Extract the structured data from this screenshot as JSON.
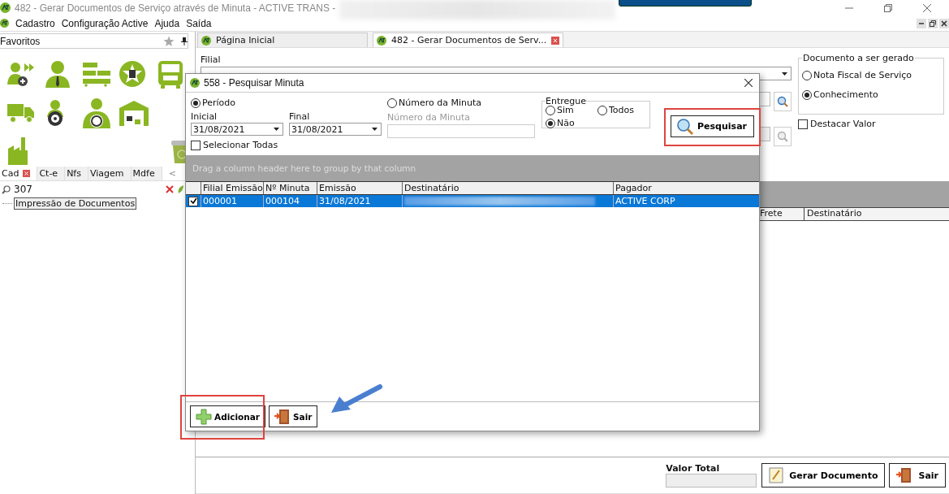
{
  "window": {
    "title": "482 - Gerar Documentos de Serviço através de Minuta - ACTIVE TRANS -"
  },
  "menu": [
    "Cadastro",
    "Configuração Active",
    "Ajuda",
    "Saída"
  ],
  "favorites": {
    "title": "Favoritos"
  },
  "side_tabs": [
    {
      "label": "Cad",
      "selected": true,
      "closable": true
    },
    {
      "label": "Ct-e",
      "selected": false,
      "closable": false
    },
    {
      "label": "Nfs",
      "selected": false,
      "closable": false
    },
    {
      "label": "Viagem",
      "selected": false,
      "closable": false
    },
    {
      "label": "Mdfe",
      "selected": false,
      "closable": false
    }
  ],
  "side_nav": "<",
  "side_search": {
    "value": "307"
  },
  "tree": [
    {
      "label": "Impressão de Documentos",
      "selected": true
    }
  ],
  "doc_tabs": [
    {
      "label": "Página Inicial",
      "selected": false,
      "closable": false
    },
    {
      "label": "482 - Gerar Documentos de Serv...",
      "selected": true,
      "closable": true
    }
  ],
  "form": {
    "filial_label": "Filial",
    "document_group": {
      "title": "Documento a ser gerado",
      "options": [
        {
          "label": "Nota Fiscal de Serviço",
          "selected": false
        },
        {
          "label": "Conhecimento",
          "selected": true
        }
      ]
    },
    "destacar": {
      "label": "Destacar Valor",
      "checked": false
    }
  },
  "main_grid": {
    "columns": [
      "Frete",
      "Destinatário"
    ]
  },
  "footer": {
    "total_label": "Valor Total",
    "buttons": [
      {
        "label": "Gerar Documento",
        "kind": "generate"
      },
      {
        "label": "Sair",
        "kind": "exit"
      }
    ]
  },
  "dialog": {
    "title": "558 - Pesquisar Minuta",
    "modes": [
      {
        "label": "Período",
        "selected": true
      },
      {
        "label": "Número da Minuta",
        "selected": false
      }
    ],
    "inicial": {
      "label": "Inicial",
      "value": "31/08/2021"
    },
    "final": {
      "label": "Final",
      "value": "31/08/2021"
    },
    "numero": {
      "label": "Número da Minuta",
      "disabled": true
    },
    "entregue": {
      "title": "Entregue",
      "options": [
        {
          "label": "Sim",
          "selected": false
        },
        {
          "label": "Todos",
          "selected": false
        },
        {
          "label": "Não",
          "selected": true
        }
      ]
    },
    "search_button": "Pesquisar",
    "select_all": {
      "label": "Selecionar Todas",
      "checked": false
    },
    "group_hint": "Drag a column header here to group by that column",
    "columns": [
      "Filial Emissão",
      "Nº Minuta",
      "Emissão",
      "Destinatário",
      "Pagador"
    ],
    "rows": [
      {
        "checked": true,
        "selected": true,
        "filial": "000001",
        "minuta": "000104",
        "emissao": "31/08/2021",
        "pagador": "ACTIVE CORP"
      }
    ],
    "buttons": [
      {
        "label": "Adicionar",
        "kind": "add"
      },
      {
        "label": "Sair",
        "kind": "exit"
      }
    ]
  }
}
